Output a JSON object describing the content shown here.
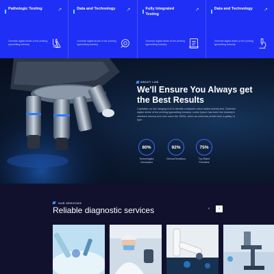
{
  "cards": [
    {
      "title": "Pathologic Testing",
      "text": "Override digital divide of the printing typesetting industry",
      "icon": "flask-icon"
    },
    {
      "title": "Data and Technology",
      "text": "Override digital divide of the printing typesetting industry",
      "icon": "microscope-slide-icon"
    },
    {
      "title": "Fully Integrated Testing",
      "text": "Override digital divide of the printing typesetting industry",
      "icon": "clipboard-icon"
    },
    {
      "title": "Data and Technology",
      "text": "Override digital divide of the printing typesetting industry",
      "icon": "microscope-icon"
    }
  ],
  "card_arrow": "↗",
  "hero": {
    "tag": "ABOUT LAB",
    "title": "We'll Ensure You Always get the Best Results",
    "text": "Capitalise on low hanging fruit to identify a ballpark value added activity text. Override digital divide of the printing typesetting industry. Lorem Ipsum has been the industry's standard dummy text ever since the 1500s, when an unknown printer took a galley of type.",
    "stats": [
      {
        "value": "80%",
        "label": "Technologies Developed"
      },
      {
        "value": "92%",
        "label": "Clinical Decisions"
      },
      {
        "value": "75%",
        "label": "Top Rated Providers"
      }
    ]
  },
  "services": {
    "tag": "OUR SERVICES",
    "title": "Reliable diagnostic services",
    "prev": "‹",
    "next": "›"
  },
  "colors": {
    "brand_blue": "#1f2ff5",
    "dark_bg": "#11112e",
    "accent_cyan": "#6ae0ff"
  }
}
